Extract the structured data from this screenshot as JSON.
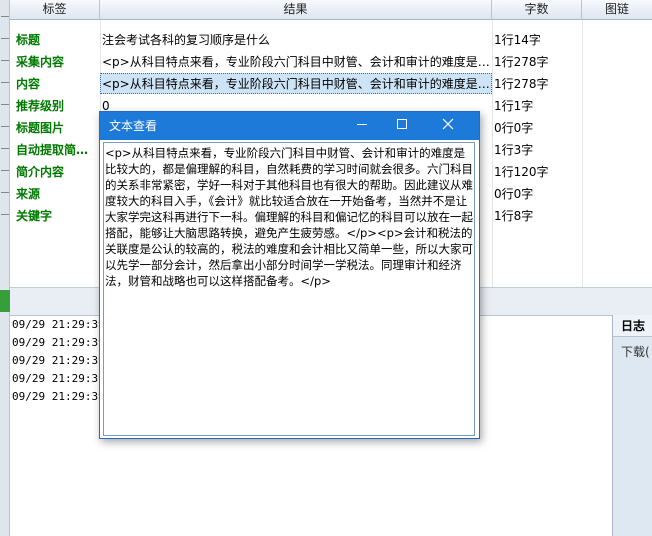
{
  "grid": {
    "headers": {
      "tag": "标签",
      "result": "结果",
      "count": "字数",
      "chart": "图链"
    },
    "rows": [
      {
        "tag": "标题",
        "result": "注会考试各科的复习顺序是什么",
        "count": "1行14字"
      },
      {
        "tag": "采集内容",
        "result": "<p>从科目特点来看，专业阶段六门科目中财管、会计和审计的难度是…",
        "count": "1行278字"
      },
      {
        "tag": "内容",
        "result": "<p>从科目特点来看，专业阶段六门科目中财管、会计和审计的难度是…",
        "count": "1行278字"
      },
      {
        "tag": "推荐级别",
        "result": "0",
        "count": "1行1字"
      },
      {
        "tag": "标题图片",
        "result": "",
        "count": "0行0字"
      },
      {
        "tag": "自动提取简…",
        "result": "",
        "count": "1行3字"
      },
      {
        "tag": "简介内容",
        "result": "",
        "count": "1行120字"
      },
      {
        "tag": "来源",
        "result": "",
        "count": "0行0字"
      },
      {
        "tag": "关键字",
        "result": "",
        "count": "1行8字"
      }
    ]
  },
  "log": {
    "lines": [
      "09/29 21:29:39",
      "09/29 21:29:39",
      "09/29 21:29:39",
      "09/29 21:29:39",
      "09/29 21:29:39"
    ]
  },
  "side_panel": {
    "title": "日志",
    "item": "下载("
  },
  "dialog": {
    "title": "文本查看",
    "minimize_icon": "minimize-icon",
    "maximize_icon": "maximize-icon",
    "close_icon": "close-icon",
    "text": "<p>从科目特点来看，专业阶段六门科目中财管、会计和审计的难度是比较大的，都是偏理解的科目，自然耗费的学习时间就会很多。六门科目的关系非常紧密，学好一科对于其他科目也有很大的帮助。因此建议从难度较大的科目入手，《会计》就比较适合放在一开始备考，当然并不是让大家学完这科再进行下一科。偏理解的科目和偏记忆的科目可以放在一起搭配，能够让大脑思路转换，避免产生疲劳感。</p><p>会计和税法的关联度是公认的较高的，税法的难度和会计相比又简单一些，所以大家可以先学一部分会计，然后拿出小部分时间学一学税法。同理审计和经济法，财管和战略也可以这样搭配备考。</p>"
  },
  "colors": {
    "accent": "#1e7ad9",
    "tag_green": "#007a00",
    "selection": "#cde3f6"
  }
}
